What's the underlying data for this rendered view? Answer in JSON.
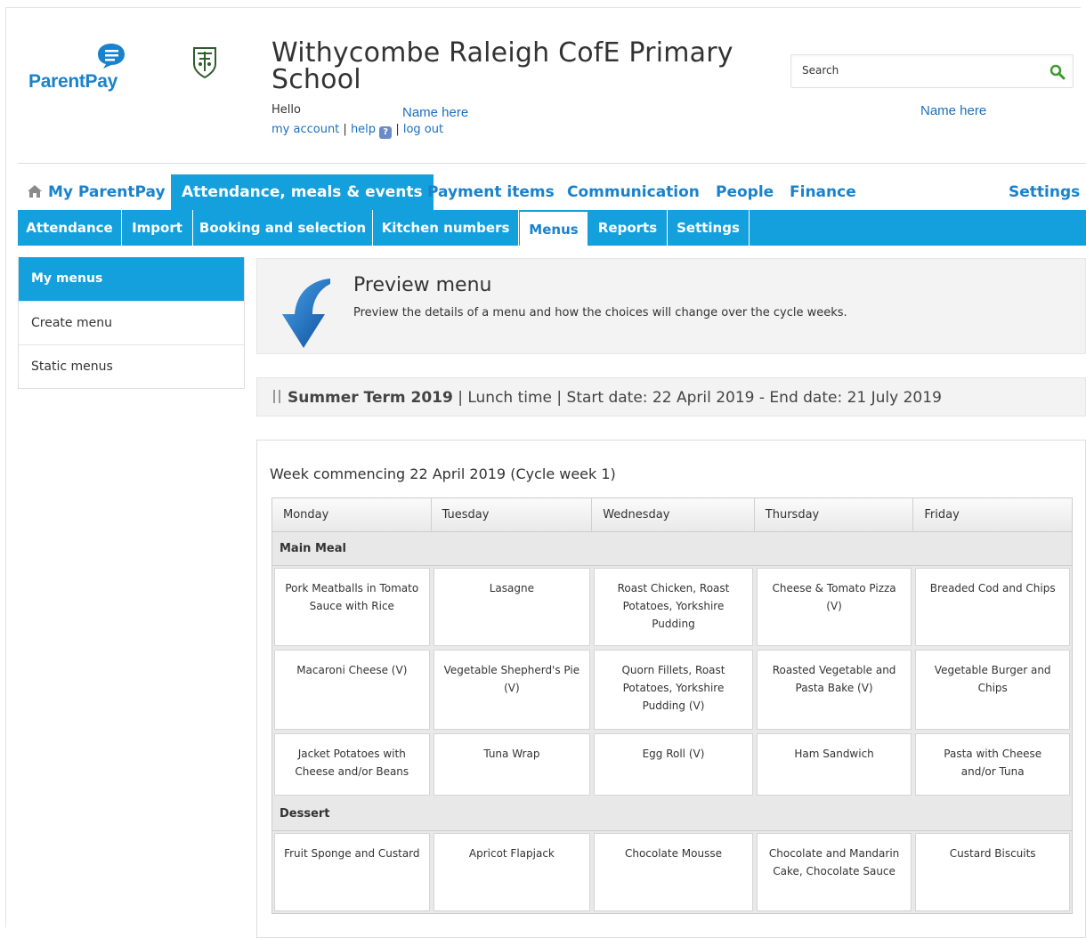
{
  "header": {
    "logo_text": "ParentPay",
    "school_name": "Withycombe Raleigh CofE Primary School",
    "hello": "Hello",
    "name_left": "Name here",
    "name_right": "Name here",
    "my_account": "my account",
    "help": "help",
    "help_glyph": "?",
    "log_out": "log out",
    "sep": " | ",
    "search_placeholder": "Search"
  },
  "topnav": {
    "my_parentpay": "My ParentPay",
    "attendance": "Attendance, meals & events",
    "payment_items": "Payment items",
    "communication": "Communication",
    "people": "People",
    "finance": "Finance",
    "settings": "Settings"
  },
  "subnav": {
    "attendance": "Attendance",
    "import": "Import",
    "booking": "Booking and selection",
    "kitchen": "Kitchen numbers",
    "menus": "Menus",
    "reports": "Reports",
    "settings": "Settings"
  },
  "sidemenu": {
    "my_menus": "My menus",
    "create_menu": "Create menu",
    "static_menus": "Static menus"
  },
  "preview": {
    "title": "Preview menu",
    "description": "Preview the details of a menu and how the choices will change over the cycle weeks."
  },
  "term": {
    "name": "Summer Term 2019",
    "details": " | Lunch time | Start date: 22 April 2019 - End date: 21 July 2019"
  },
  "menu": {
    "week_title": "Week commencing 22 April 2019 (Cycle week 1)",
    "days": [
      "Monday",
      "Tuesday",
      "Wednesday",
      "Thursday",
      "Friday"
    ],
    "main_meal_label": "Main Meal",
    "main_meal_rows": [
      [
        "Pork Meatballs in Tomato Sauce with Rice",
        "Lasagne",
        "Roast Chicken, Roast Potatoes, Yorkshire Pudding",
        "Cheese & Tomato Pizza (V)",
        "Breaded Cod and Chips"
      ],
      [
        "Macaroni Cheese (V)",
        "Vegetable Shepherd's Pie (V)",
        "Quorn Fillets, Roast Potatoes, Yorkshire Pudding (V)",
        "Roasted Vegetable and Pasta Bake (V)",
        "Vegetable Burger and Chips"
      ],
      [
        "Jacket Potatoes with Cheese and/or Beans",
        "Tuna Wrap",
        "Egg Roll (V)",
        "Ham Sandwich",
        "Pasta with Cheese and/or Tuna"
      ]
    ],
    "dessert_label": "Dessert",
    "dessert_row": [
      "Fruit Sponge and Custard",
      "Apricot Flapjack",
      "Chocolate Mousse",
      "Chocolate and Mandarin Cake, Chocolate Sauce",
      "Custard Biscuits"
    ]
  },
  "colors": {
    "brand_blue": "#14a0dc",
    "link_blue": "#1a82cc"
  }
}
